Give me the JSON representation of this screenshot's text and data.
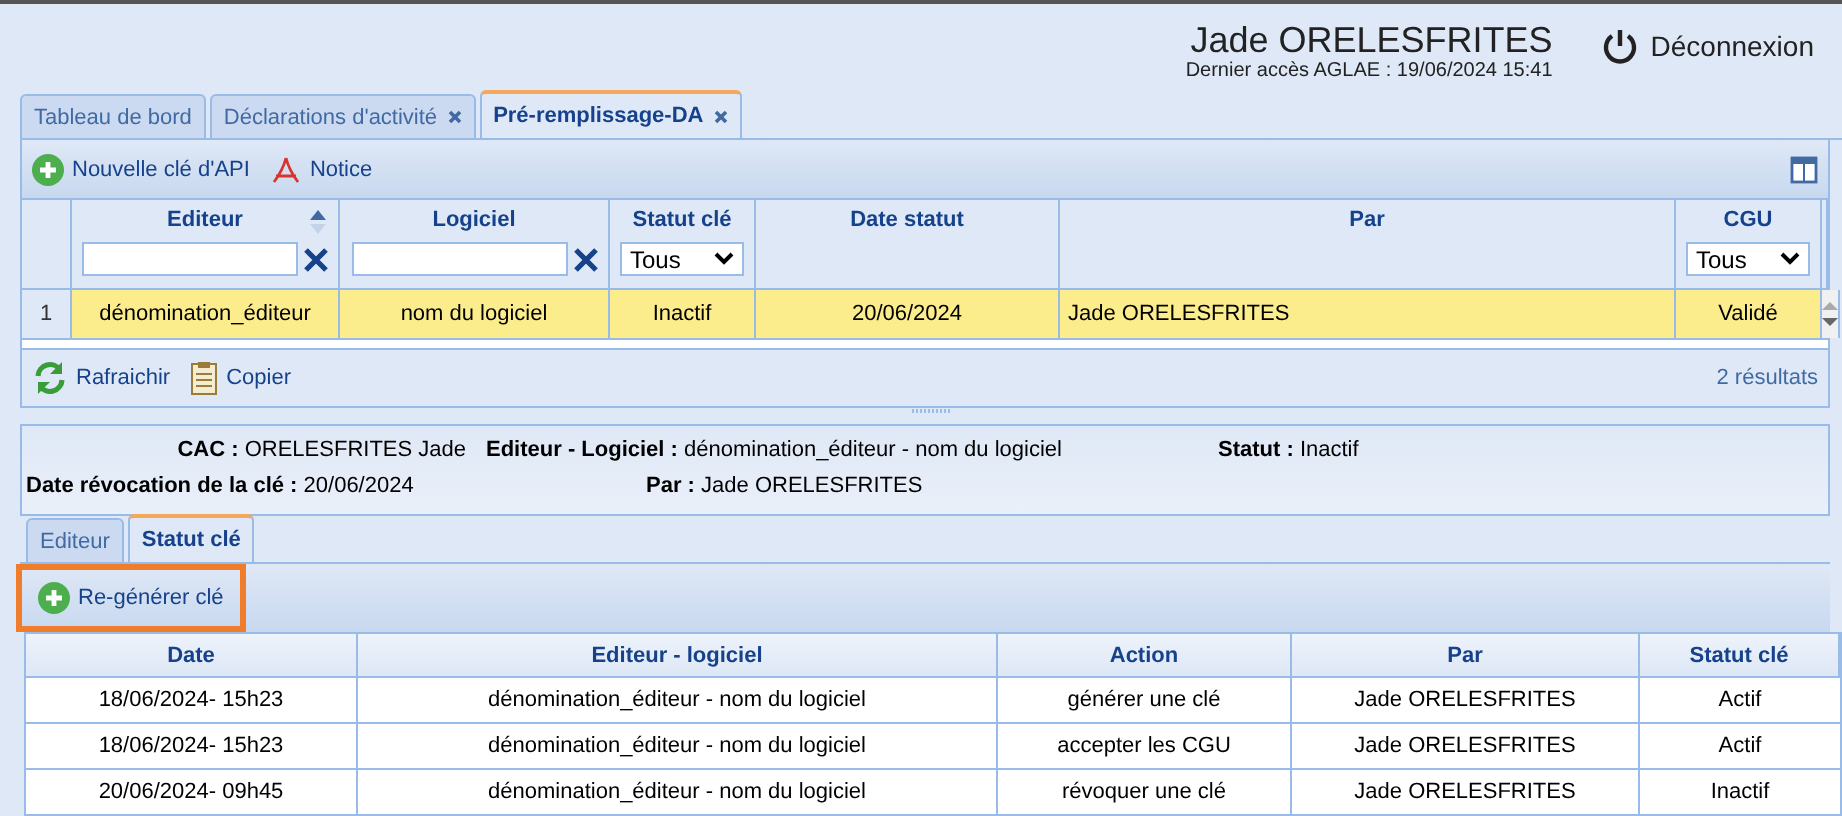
{
  "header": {
    "user_name": "Jade ORELESFRITES",
    "last_access": "Dernier accès AGLAE : 19/06/2024 15:41",
    "logout": "Déconnexion"
  },
  "tabs": [
    {
      "label": "Tableau de bord",
      "closable": false,
      "selected": false
    },
    {
      "label": "Déclarations d'activité",
      "closable": true,
      "selected": false
    },
    {
      "label": "Pré-remplissage-DA",
      "closable": true,
      "selected": true
    }
  ],
  "toolbar": [
    {
      "label": "Nouvelle clé d'API",
      "kind": "add"
    },
    {
      "label": "Notice",
      "kind": "pdf"
    }
  ],
  "grid": {
    "columns": [
      {
        "label": "Editeur",
        "kind": "text",
        "sortable": true
      },
      {
        "label": "Logiciel",
        "kind": "text",
        "sortable": false
      },
      {
        "label": "Statut clé",
        "kind": "select",
        "filter_value": "Tous",
        "sortable": false
      },
      {
        "label": "Date statut",
        "kind": "plain",
        "sortable": false
      },
      {
        "label": "Par",
        "kind": "plain",
        "sortable": false
      },
      {
        "label": "CGU",
        "kind": "select",
        "filter_value": "Tous",
        "sortable": false
      }
    ],
    "rows": [
      {
        "number": "1",
        "selected": true,
        "cells": [
          "dénomination_éditeur",
          "nom du logiciel",
          "Inactif",
          "20/06/2024",
          "Jade ORELESFRITES",
          "Validé"
        ]
      }
    ]
  },
  "footer": {
    "buttons": [
      {
        "label": "Rafraichir",
        "kind": "refresh"
      },
      {
        "label": "Copier",
        "kind": "copy"
      }
    ],
    "result_count": "2 résultats"
  },
  "detail": {
    "rows": [
      [
        {
          "label": "CAC :",
          "value": "ORELESFRITES Jade"
        },
        {
          "label": "Editeur - Logiciel :",
          "value": "dénomination_éditeur - nom du logiciel"
        },
        {
          "label": "Statut :",
          "value": "Inactif"
        }
      ],
      [
        {
          "label": "Date révocation de la clé :",
          "value": "20/06/2024"
        },
        {
          "label": "Par :",
          "value": "Jade ORELESFRITES"
        }
      ]
    ]
  },
  "sub_tabs": [
    {
      "label": "Editeur",
      "selected": false
    },
    {
      "label": "Statut clé",
      "selected": true
    }
  ],
  "action_button": {
    "label": "Re-générer clé",
    "highlighted": true
  },
  "history": {
    "columns": [
      "Date",
      "Editeur - logiciel",
      "Action",
      "Par",
      "Statut clé"
    ],
    "rows": [
      [
        "18/06/2024- 15h23",
        "dénomination_éditeur - nom du logiciel",
        "générer une clé",
        "Jade ORELESFRITES",
        "Actif"
      ],
      [
        "18/06/2024- 15h23",
        "dénomination_éditeur - nom du logiciel",
        "accepter les CGU",
        "Jade ORELESFRITES",
        "Actif"
      ],
      [
        "20/06/2024- 09h45",
        "dénomination_éditeur - nom du logiciel",
        "révoquer une clé",
        "Jade ORELESFRITES",
        "Inactif"
      ]
    ]
  }
}
